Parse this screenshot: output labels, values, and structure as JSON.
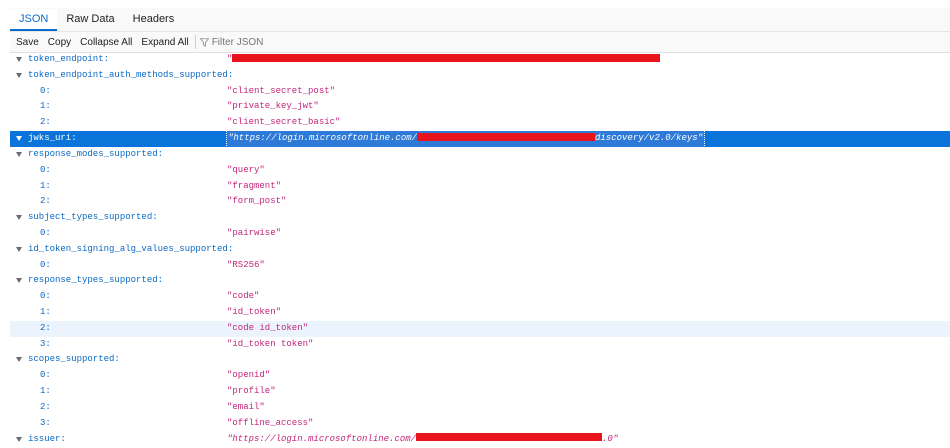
{
  "tabs": [
    "JSON",
    "Raw Data",
    "Headers"
  ],
  "active_tab": "JSON",
  "toolbar": {
    "save": "Save",
    "copy": "Copy",
    "collapse_all": "Collapse All",
    "expand_all": "Expand All",
    "filter_placeholder": "Filter JSON"
  },
  "rows": [
    {
      "key": "token_endpoint:",
      "value": "\"",
      "redacted": true,
      "kind": "prop"
    },
    {
      "key": "token_endpoint_auth_methods_supported:",
      "kind": "array"
    },
    {
      "key": "0:",
      "value": "\"client_secret_post\"",
      "kind": "item"
    },
    {
      "key": "1:",
      "value": "\"private_key_jwt\"",
      "kind": "item"
    },
    {
      "key": "2:",
      "value": "\"client_secret_basic\"",
      "kind": "item"
    },
    {
      "key": "jwks_uri:",
      "value_prefix": "\"https://login.microsoftonline.com/",
      "value_suffix": "discovery/v2.0/keys\"",
      "kind": "prop",
      "selected": true
    },
    {
      "key": "response_modes_supported:",
      "kind": "array"
    },
    {
      "key": "0:",
      "value": "\"query\"",
      "kind": "item"
    },
    {
      "key": "1:",
      "value": "\"fragment\"",
      "kind": "item"
    },
    {
      "key": "2:",
      "value": "\"form_post\"",
      "kind": "item"
    },
    {
      "key": "subject_types_supported:",
      "kind": "array"
    },
    {
      "key": "0:",
      "value": "\"pairwise\"",
      "kind": "item"
    },
    {
      "key": "id_token_signing_alg_values_supported:",
      "kind": "array"
    },
    {
      "key": "0:",
      "value": "\"RS256\"",
      "kind": "item"
    },
    {
      "key": "response_types_supported:",
      "kind": "array"
    },
    {
      "key": "0:",
      "value": "\"code\"",
      "kind": "item"
    },
    {
      "key": "1:",
      "value": "\"id_token\"",
      "kind": "item"
    },
    {
      "key": "2:",
      "value": "\"code id_token\"",
      "kind": "item",
      "hover": true
    },
    {
      "key": "3:",
      "value": "\"id_token token\"",
      "kind": "item"
    },
    {
      "key": "scopes_supported:",
      "kind": "array"
    },
    {
      "key": "0:",
      "value": "\"openid\"",
      "kind": "item"
    },
    {
      "key": "1:",
      "value": "\"profile\"",
      "kind": "item"
    },
    {
      "key": "2:",
      "value": "\"email\"",
      "kind": "item"
    },
    {
      "key": "3:",
      "value": "\"offline_access\"",
      "kind": "item"
    },
    {
      "key": "issuer:",
      "value_prefix": "\"https://login.microsoftonline.com/",
      "value_suffix": ".0\"",
      "kind": "prop"
    }
  ],
  "colors": {
    "key": "#0a69c4",
    "string": "#c3257a",
    "selected": "#0a74db",
    "redaction": "#e8131b"
  }
}
